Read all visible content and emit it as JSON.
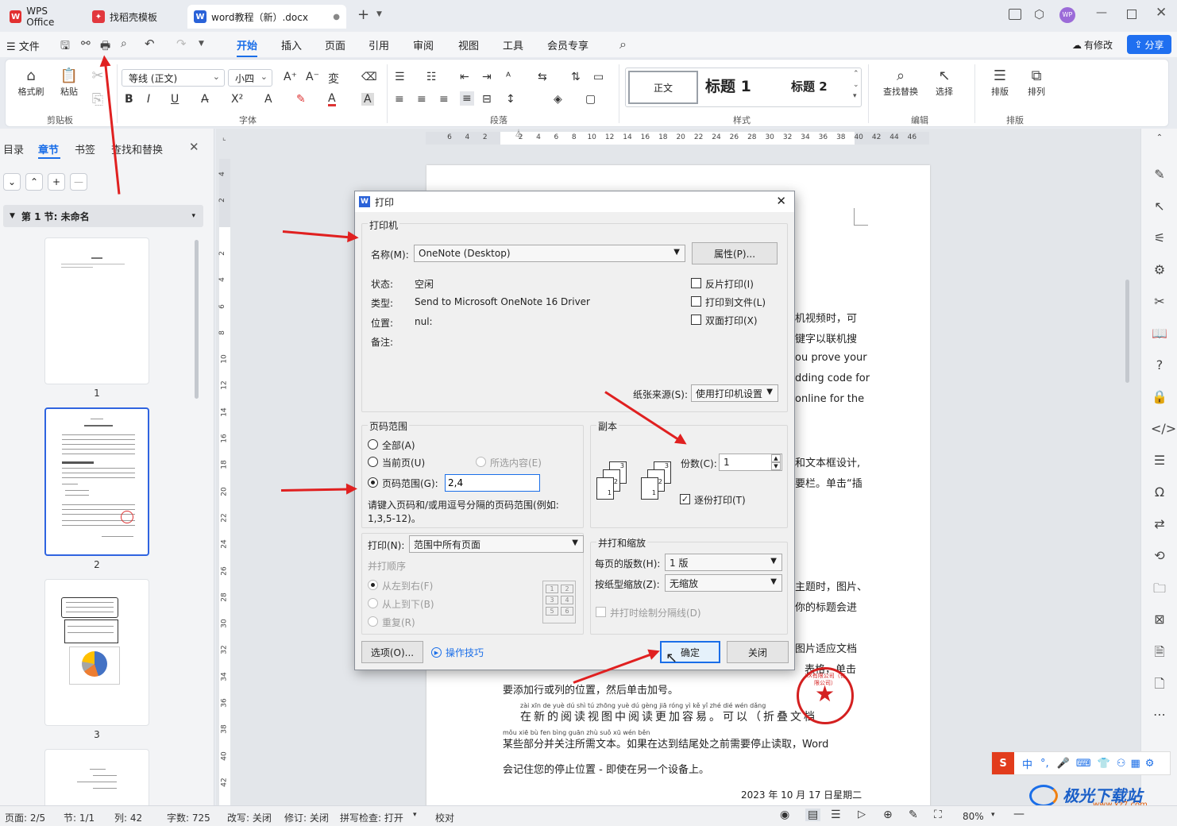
{
  "titlebar": {
    "tabs": [
      {
        "label": "WPS Office"
      },
      {
        "label": "找稻壳模板"
      },
      {
        "label": "word教程（新）.docx"
      }
    ],
    "add_tab": "+"
  },
  "menubar": {
    "file": "文件",
    "items": [
      "开始",
      "插入",
      "页面",
      "引用",
      "审阅",
      "视图",
      "工具",
      "会员专享"
    ],
    "active": "开始",
    "modified": "有修改",
    "share": "分享"
  },
  "ribbon": {
    "format_painter": "格式刷",
    "paste": "粘贴",
    "clipboard_label": "剪贴板",
    "font_name": "等线 (正文)",
    "font_size": "小四",
    "font_label": "字体",
    "para_label": "段落",
    "styles": [
      "正文",
      "标题 1",
      "标题 2"
    ],
    "style_label": "样式",
    "find_replace": "查找替换",
    "select": "选择",
    "edit_label": "编辑",
    "layout": "排版",
    "arrange": "排列",
    "layout_label": "排版"
  },
  "leftpanel": {
    "tabs": [
      "目录",
      "章节",
      "书签",
      "查找和替换"
    ],
    "active_tab": "章节",
    "section_title": "第 1 节: 未命名",
    "pages": [
      "1",
      "2",
      "3"
    ]
  },
  "ruler": {
    "h_ticks": [
      "6",
      "4",
      "2",
      "",
      "2",
      "4",
      "6",
      "8",
      "10",
      "12",
      "14",
      "16",
      "18",
      "20",
      "22",
      "24",
      "26",
      "28",
      "30",
      "32",
      "34",
      "36",
      "38",
      "40",
      "42",
      "44",
      "46"
    ],
    "v_ticks": [
      "4",
      "2",
      "",
      "2",
      "4",
      "6",
      "8",
      "10",
      "12",
      "14",
      "16",
      "18",
      "20",
      "22",
      "24",
      "26",
      "28",
      "30",
      "32",
      "34",
      "36",
      "38",
      "40",
      "42"
    ]
  },
  "document": {
    "lines_right": [
      "机视频时，可",
      "键字以联机搜",
      "ou prove your",
      "dding code for",
      "online for the",
      "和文本框设计,",
      "要栏。单击“插",
      "主题时，图片、",
      "你的标题会进",
      "图片适应文档",
      "表格，单击"
    ],
    "line1": "要添加行或列的位置，然后单击加号。",
    "line2": "在新的阅读视图中阅读更加容易。可以（折叠文档",
    "line2_pinyin": "zài xīn de yuè dú shì tú zhōng yuè dú gèng jiā róng yì  kě yǐ    zhé dié wén dǎng",
    "line3": "某些部分并关注所需文本。如果在达到结尾处之前需要停止读取，Word",
    "line3_pinyin": "mǒu xiē bù fen bìng guān zhù suǒ xū wén běn",
    "line4": "会记住您的停止位置 - 即使在另一个设备上。",
    "date": "2023 年 10 月 17 日星期二"
  },
  "dialog": {
    "title": "打印",
    "printer_group": "打印机",
    "name_label": "名称(M):",
    "printer_name": "OneNote (Desktop)",
    "props_button": "属性(P)...",
    "status_label": "状态:",
    "status_value": "空闲",
    "type_label": "类型:",
    "type_value": "Send to Microsoft OneNote 16 Driver",
    "where_label": "位置:",
    "where_value": "nul:",
    "comment_label": "备注:",
    "reverse_print": "反片打印(I)",
    "print_to_file": "打印到文件(L)",
    "duplex": "双面打印(X)",
    "paper_source_label": "纸张来源(S):",
    "paper_source_value": "使用打印机设置",
    "range_group": "页码范围",
    "range_all": "全部(A)",
    "range_current": "当前页(U)",
    "range_selection": "所选内容(E)",
    "range_pages": "页码范围(G):",
    "range_pages_value": "2,4",
    "range_hint": "请键入页码和/或用逗号分隔的页码范围(例如:",
    "range_hint2": "1,3,5-12)。",
    "copies_group": "副本",
    "copies_label": "份数(C):",
    "copies_value": "1",
    "collate": "逐份打印(T)",
    "print_label": "打印(N):",
    "print_value": "范围中所有页面",
    "order_group": "并打顺序",
    "order_lr": "从左到右(F)",
    "order_tb": "从上到下(B)",
    "order_repeat": "重复(R)",
    "zoom_group": "并打和缩放",
    "pages_per_sheet_label": "每页的版数(H):",
    "pages_per_sheet_value": "1 版",
    "scale_label": "按纸型缩放(Z):",
    "scale_value": "无缩放",
    "draw_separator": "并打时绘制分隔线(D)",
    "options_button": "选项(O)...",
    "tips_link": "操作技巧",
    "ok_button": "确定",
    "close_button": "关闭",
    "order_grid": [
      "1",
      "2",
      "3",
      "4",
      "5",
      "6"
    ]
  },
  "statusbar": {
    "page": "页面: 2/5",
    "section": "节: 1/1",
    "column": "列: 42",
    "words": "字数: 725",
    "revise_mode": "改写: 关闭",
    "track": "修订: 关闭",
    "spell": "拼写检查: 打开",
    "proof": "校对",
    "zoom": "80%"
  },
  "ime": {
    "chars": [
      "中",
      "°,"
    ]
  },
  "watermark": {
    "text": "极光下载站",
    "url": "www.xz7.com"
  },
  "stamp_text": "XX有限公司（有限公司）",
  "colors": {
    "accent": "#1a6ee8",
    "arrow": "#e02020",
    "stamp": "#d42020"
  }
}
